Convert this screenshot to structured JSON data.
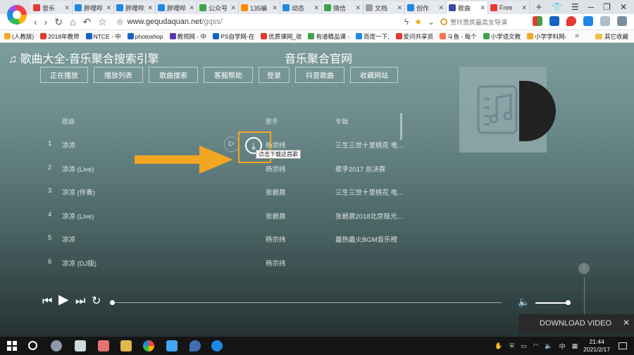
{
  "browser": {
    "tabs": [
      {
        "title": "音乐",
        "icon_color": "#e53935",
        "active": false
      },
      {
        "title": "胖哩哔",
        "icon_color": "#1e88e5",
        "active": false
      },
      {
        "title": "胖哩哔",
        "icon_color": "#1e88e5",
        "active": false
      },
      {
        "title": "胖哩哔",
        "icon_color": "#1e88e5",
        "active": false
      },
      {
        "title": "公众号",
        "icon_color": "#43a047",
        "active": false
      },
      {
        "title": "135编",
        "icon_color": "#fb8c00",
        "active": false
      },
      {
        "title": "动态",
        "icon_color": "#1e88e5",
        "active": false
      },
      {
        "title": "微信",
        "icon_color": "#43a047",
        "active": false
      },
      {
        "title": "文档",
        "icon_color": "#9e9e9e",
        "active": false
      },
      {
        "title": "创作",
        "icon_color": "#1e88e5",
        "active": false
      },
      {
        "title": "歌曲",
        "icon_color": "#3949ab",
        "active": true
      },
      {
        "title": "Free",
        "icon_color": "#e53935",
        "active": false
      }
    ],
    "new_tab_label": "+",
    "url_host": "www.gequdaquan.net",
    "url_path": "/gqss/",
    "search_placeholder": "贾玲票房最高女导演",
    "bookmarks": [
      {
        "label": "(人教版)",
        "icon_color": "#f9a825"
      },
      {
        "label": "2018年教师",
        "icon_color": "#e53935"
      },
      {
        "label": "NTCE - 中",
        "icon_color": "#1565c0"
      },
      {
        "label": "photoshop",
        "icon_color": "#1565c0"
      },
      {
        "label": "教视网 - 中",
        "icon_color": "#5e35b1"
      },
      {
        "label": "PS自学网-在",
        "icon_color": "#1565c0"
      },
      {
        "label": "优质课网_收",
        "icon_color": "#e53935"
      },
      {
        "label": "有道精品课 -",
        "icon_color": "#43a047"
      },
      {
        "label": "百度一下,",
        "icon_color": "#1e88e5"
      },
      {
        "label": "爱问共享资",
        "icon_color": "#e53935"
      },
      {
        "label": "斗鱼 - 每个",
        "icon_color": "#ff7043"
      },
      {
        "label": "小学语文教",
        "icon_color": "#43a047"
      },
      {
        "label": "小学学科网-",
        "icon_color": "#f9a825"
      }
    ],
    "bookmarks_more": "»",
    "other_bookmarks": "其它收藏"
  },
  "site": {
    "title": "♫ 歌曲大全-音乐聚合搜索引擎",
    "subtitle": "音乐聚合官网",
    "nav": [
      {
        "label": "正在播放"
      },
      {
        "label": "播放列表"
      },
      {
        "label": "歌曲搜索"
      },
      {
        "label": "客服帮助"
      },
      {
        "label": "登录"
      },
      {
        "label": "抖音歌曲"
      },
      {
        "label": "收藏网站"
      }
    ],
    "table_headers": {
      "song": "歌曲",
      "singer": "歌手",
      "album": "专辑"
    },
    "rows": [
      {
        "num": "1",
        "song": "凉凉",
        "singer": "杨宗纬",
        "album": "三生三世十里桃花 电..."
      },
      {
        "num": "2",
        "song": "凉凉 (Live)",
        "singer": "杨宗纬",
        "album": "歌手2017 总决赛"
      },
      {
        "num": "3",
        "song": "凉凉 (伴奏)",
        "singer": "张碧晨",
        "album": "三生三世十里桃花 电..."
      },
      {
        "num": "4",
        "song": "凉凉 (Live)",
        "singer": "张碧晨",
        "album": "张碧晨2018北京极光..."
      },
      {
        "num": "5",
        "song": "凉凉",
        "singer": "杨宗纬",
        "album": "最热最火BGM音乐榜"
      },
      {
        "num": "6",
        "song": "凉凉 (DJ版)",
        "singer": "杨宗纬",
        "album": ""
      }
    ],
    "download_tooltip": "点击下载这首歌",
    "player": {
      "progress": 0.0,
      "volume": 0.86
    },
    "download_video_label": "DOWNLOAD VIDEO"
  },
  "taskbar": {
    "time": "21:44",
    "date": "2021/2/17",
    "ime": "中"
  },
  "colors": {
    "accent_orange": "#f3a621",
    "page_top": "#7d9d9d",
    "page_bottom": "#263232"
  }
}
